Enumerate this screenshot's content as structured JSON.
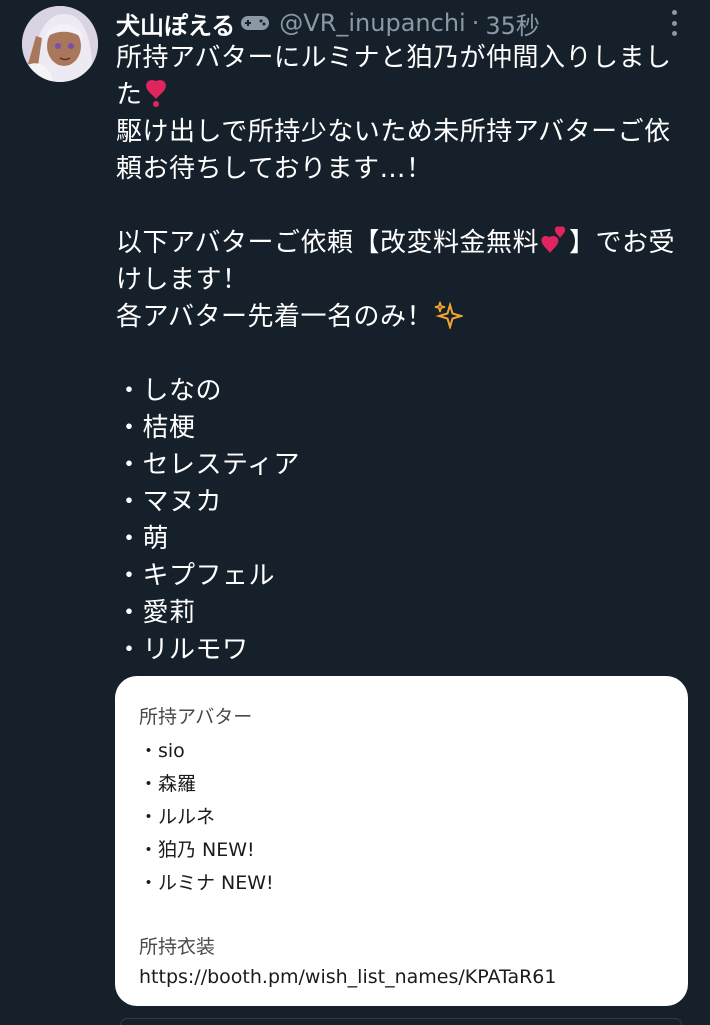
{
  "tweet": {
    "display_name": "犬山ぽえる",
    "name_icon": "gamepad-icon",
    "handle": "@VR_inupanchi",
    "separator": "·",
    "time": "35秒",
    "more_icon": "more-vertical-icon",
    "lines": [
      "所持アバターにルミナと狛乃が仲間入りしまし",
      "た",
      "駆け出しで所持少ないため未所持アバターご依",
      "頼お待ちしております…！",
      "以下アバターご依頼【改変料金無料",
      "】でお受",
      "けします！",
      "各アバター先着一名のみ！"
    ],
    "emoji": {
      "heart": "heart-exclamation-icon",
      "two_hearts": "two-hearts-icon",
      "sparkles": "sparkles-icon"
    },
    "list_items": [
      "・しなの",
      "・桔梗",
      "・セレスティア",
      "・マヌカ",
      "・萌",
      "・キプフェル",
      "・愛莉",
      "・リルモワ"
    ]
  },
  "card": {
    "heading": "所持アバター",
    "items": [
      "・sio",
      "・森羅",
      "・ルルネ",
      "・狛乃 NEW!",
      "・ルミナ NEW!"
    ],
    "outfits_heading": "所持衣装",
    "url": "https://booth.pm/wish_list_names/KPATaR61"
  },
  "colors": {
    "background": "#15202b",
    "secondary_text": "#8b98a5",
    "heart_red": "#e0245e",
    "sparkle_gold": "#f4a630"
  }
}
